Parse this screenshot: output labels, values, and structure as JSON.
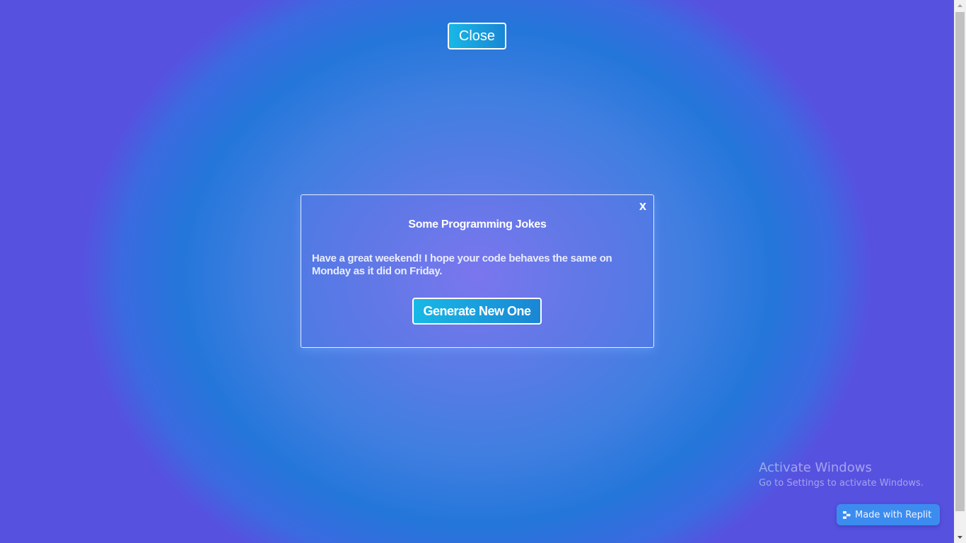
{
  "page": {
    "close_button": "Close"
  },
  "modal": {
    "close_x": "x",
    "title": "Some Programming Jokes",
    "joke": "Have a great weekend! I hope your code behaves the same on Monday as it did on Friday.",
    "generate_button": "Generate New One"
  },
  "watermark": {
    "title": "Activate Windows",
    "subtitle": "Go to Settings to activate Windows."
  },
  "badge": {
    "label": "Made with Replit",
    "icon": "replit-icon"
  },
  "colors": {
    "button_gradient_start": "#18b8e6",
    "button_gradient_end": "#1a86d4",
    "background_center": "#7b78ee",
    "background_mid": "#2476da",
    "badge_bg": "#3c8cf0"
  }
}
